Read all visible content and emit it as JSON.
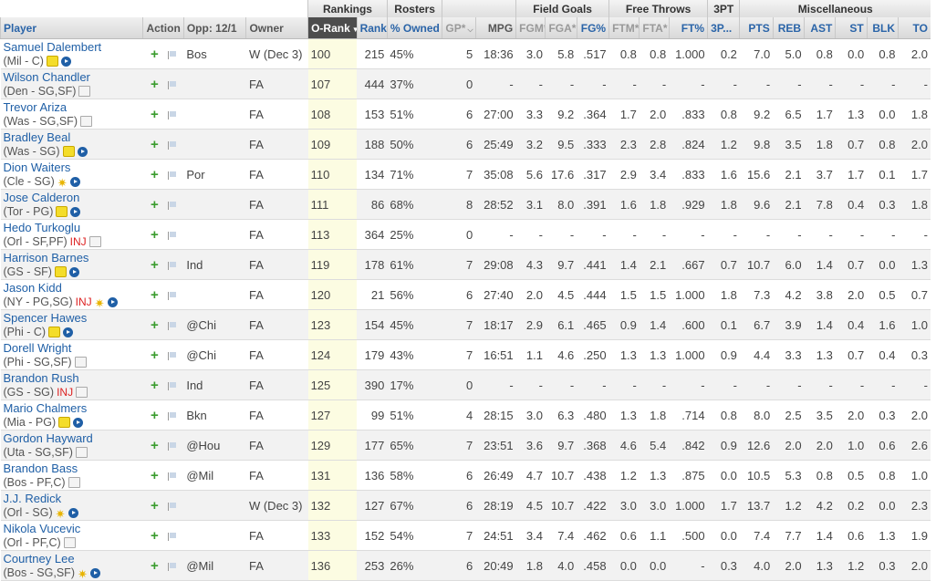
{
  "group_headers": {
    "rankings": "Rankings",
    "rosters": "Rosters",
    "field_goals": "Field Goals",
    "free_throws": "Free Throws",
    "three_pt": "3PT",
    "misc": "Miscellaneous"
  },
  "columns": {
    "player": "Player",
    "action": "Action",
    "opp": "Opp: 12/1",
    "owner": "Owner",
    "orank": "O-Rank",
    "rank": "Rank",
    "owned": "% Owned",
    "gp": "GP*",
    "mpg": "MPG",
    "fgm": "FGM*",
    "fga": "FGA*",
    "fgp": "FG%",
    "ftm": "FTM*",
    "fta": "FTA*",
    "ftp": "FT%",
    "tpm": "3P...",
    "pts": "PTS",
    "reb": "REB",
    "ast": "AST",
    "st": "ST",
    "blk": "BLK",
    "to": "TO"
  },
  "rows": [
    {
      "name": "Samuel Dalembert",
      "team": "(Mil - C)",
      "inj": "",
      "note": "yellow",
      "opp": "Bos",
      "owner": "W (Dec 3)",
      "orank": "100",
      "rank": "215",
      "owned": "45%",
      "gp": "5",
      "mpg": "18:36",
      "fgm": "3.0",
      "fga": "5.8",
      "fgp": ".517",
      "ftm": "0.8",
      "fta": "0.8",
      "ftp": "1.000",
      "tpm": "0.2",
      "pts": "7.0",
      "reb": "5.0",
      "ast": "0.8",
      "st": "0.0",
      "blk": "0.8",
      "to": "2.0"
    },
    {
      "name": "Wilson Chandler",
      "team": "(Den - SG,SF)",
      "inj": "",
      "note": "gray",
      "opp": "",
      "owner": "FA",
      "orank": "107",
      "rank": "444",
      "owned": "37%",
      "gp": "0",
      "mpg": "-",
      "fgm": "-",
      "fga": "-",
      "fgp": "-",
      "ftm": "-",
      "fta": "-",
      "ftp": "-",
      "tpm": "-",
      "pts": "-",
      "reb": "-",
      "ast": "-",
      "st": "-",
      "blk": "-",
      "to": "-"
    },
    {
      "name": "Trevor Ariza",
      "team": "(Was - SG,SF)",
      "inj": "",
      "note": "gray",
      "opp": "",
      "owner": "FA",
      "orank": "108",
      "rank": "153",
      "owned": "51%",
      "gp": "6",
      "mpg": "27:00",
      "fgm": "3.3",
      "fga": "9.2",
      "fgp": ".364",
      "ftm": "1.7",
      "fta": "2.0",
      "ftp": ".833",
      "tpm": "0.8",
      "pts": "9.2",
      "reb": "6.5",
      "ast": "1.7",
      "st": "1.3",
      "blk": "0.0",
      "to": "1.8"
    },
    {
      "name": "Bradley Beal",
      "team": "(Was - SG)",
      "inj": "",
      "note": "yellow",
      "opp": "",
      "owner": "FA",
      "orank": "109",
      "rank": "188",
      "owned": "50%",
      "gp": "6",
      "mpg": "25:49",
      "fgm": "3.2",
      "fga": "9.5",
      "fgp": ".333",
      "ftm": "2.3",
      "fta": "2.8",
      "ftp": ".824",
      "tpm": "1.2",
      "pts": "9.8",
      "reb": "3.5",
      "ast": "1.8",
      "st": "0.7",
      "blk": "0.8",
      "to": "2.0"
    },
    {
      "name": "Dion Waiters",
      "team": "(Cle - SG)",
      "inj": "",
      "note": "star",
      "opp": "Por",
      "owner": "FA",
      "orank": "110",
      "rank": "134",
      "owned": "71%",
      "gp": "7",
      "mpg": "35:08",
      "fgm": "5.6",
      "fga": "17.6",
      "fgp": ".317",
      "ftm": "2.9",
      "fta": "3.4",
      "ftp": ".833",
      "tpm": "1.6",
      "pts": "15.6",
      "reb": "2.1",
      "ast": "3.7",
      "st": "1.7",
      "blk": "0.1",
      "to": "1.7"
    },
    {
      "name": "Jose Calderon",
      "team": "(Tor - PG)",
      "inj": "",
      "note": "yellow",
      "opp": "",
      "owner": "FA",
      "orank": "111",
      "rank": "86",
      "owned": "68%",
      "gp": "8",
      "mpg": "28:52",
      "fgm": "3.1",
      "fga": "8.0",
      "fgp": ".391",
      "ftm": "1.6",
      "fta": "1.8",
      "ftp": ".929",
      "tpm": "1.8",
      "pts": "9.6",
      "reb": "2.1",
      "ast": "7.8",
      "st": "0.4",
      "blk": "0.3",
      "to": "1.8"
    },
    {
      "name": "Hedo Turkoglu",
      "team": "(Orl - SF,PF)",
      "inj": "INJ",
      "note": "gray",
      "opp": "",
      "owner": "FA",
      "orank": "113",
      "rank": "364",
      "owned": "25%",
      "gp": "0",
      "mpg": "-",
      "fgm": "-",
      "fga": "-",
      "fgp": "-",
      "ftm": "-",
      "fta": "-",
      "ftp": "-",
      "tpm": "-",
      "pts": "-",
      "reb": "-",
      "ast": "-",
      "st": "-",
      "blk": "-",
      "to": "-"
    },
    {
      "name": "Harrison Barnes",
      "team": "(GS - SF)",
      "inj": "",
      "note": "yellow",
      "opp": "Ind",
      "owner": "FA",
      "orank": "119",
      "rank": "178",
      "owned": "61%",
      "gp": "7",
      "mpg": "29:08",
      "fgm": "4.3",
      "fga": "9.7",
      "fgp": ".441",
      "ftm": "1.4",
      "fta": "2.1",
      "ftp": ".667",
      "tpm": "0.7",
      "pts": "10.7",
      "reb": "6.0",
      "ast": "1.4",
      "st": "0.7",
      "blk": "0.0",
      "to": "1.3"
    },
    {
      "name": "Jason Kidd",
      "team": "(NY - PG,SG)",
      "inj": "INJ",
      "note": "star",
      "opp": "",
      "owner": "FA",
      "orank": "120",
      "rank": "21",
      "owned": "56%",
      "gp": "6",
      "mpg": "27:40",
      "fgm": "2.0",
      "fga": "4.5",
      "fgp": ".444",
      "ftm": "1.5",
      "fta": "1.5",
      "ftp": "1.000",
      "tpm": "1.8",
      "pts": "7.3",
      "reb": "4.2",
      "ast": "3.8",
      "st": "2.0",
      "blk": "0.5",
      "to": "0.7"
    },
    {
      "name": "Spencer Hawes",
      "team": "(Phi - C)",
      "inj": "",
      "note": "yellow",
      "opp": "@Chi",
      "owner": "FA",
      "orank": "123",
      "rank": "154",
      "owned": "45%",
      "gp": "7",
      "mpg": "18:17",
      "fgm": "2.9",
      "fga": "6.1",
      "fgp": ".465",
      "ftm": "0.9",
      "fta": "1.4",
      "ftp": ".600",
      "tpm": "0.1",
      "pts": "6.7",
      "reb": "3.9",
      "ast": "1.4",
      "st": "0.4",
      "blk": "1.6",
      "to": "1.0"
    },
    {
      "name": "Dorell Wright",
      "team": "(Phi - SG,SF)",
      "inj": "",
      "note": "gray",
      "opp": "@Chi",
      "owner": "FA",
      "orank": "124",
      "rank": "179",
      "owned": "43%",
      "gp": "7",
      "mpg": "16:51",
      "fgm": "1.1",
      "fga": "4.6",
      "fgp": ".250",
      "ftm": "1.3",
      "fta": "1.3",
      "ftp": "1.000",
      "tpm": "0.9",
      "pts": "4.4",
      "reb": "3.3",
      "ast": "1.3",
      "st": "0.7",
      "blk": "0.4",
      "to": "0.3"
    },
    {
      "name": "Brandon Rush",
      "team": "(GS - SG)",
      "inj": "INJ",
      "note": "gray",
      "opp": "Ind",
      "owner": "FA",
      "orank": "125",
      "rank": "390",
      "owned": "17%",
      "gp": "0",
      "mpg": "-",
      "fgm": "-",
      "fga": "-",
      "fgp": "-",
      "ftm": "-",
      "fta": "-",
      "ftp": "-",
      "tpm": "-",
      "pts": "-",
      "reb": "-",
      "ast": "-",
      "st": "-",
      "blk": "-",
      "to": "-"
    },
    {
      "name": "Mario Chalmers",
      "team": "(Mia - PG)",
      "inj": "",
      "note": "yellow",
      "opp": "Bkn",
      "owner": "FA",
      "orank": "127",
      "rank": "99",
      "owned": "51%",
      "gp": "4",
      "mpg": "28:15",
      "fgm": "3.0",
      "fga": "6.3",
      "fgp": ".480",
      "ftm": "1.3",
      "fta": "1.8",
      "ftp": ".714",
      "tpm": "0.8",
      "pts": "8.0",
      "reb": "2.5",
      "ast": "3.5",
      "st": "2.0",
      "blk": "0.3",
      "to": "2.0"
    },
    {
      "name": "Gordon Hayward",
      "team": "(Uta - SG,SF)",
      "inj": "",
      "note": "gray",
      "opp": "@Hou",
      "owner": "FA",
      "orank": "129",
      "rank": "177",
      "owned": "65%",
      "gp": "7",
      "mpg": "23:51",
      "fgm": "3.6",
      "fga": "9.7",
      "fgp": ".368",
      "ftm": "4.6",
      "fta": "5.4",
      "ftp": ".842",
      "tpm": "0.9",
      "pts": "12.6",
      "reb": "2.0",
      "ast": "2.0",
      "st": "1.0",
      "blk": "0.6",
      "to": "2.6"
    },
    {
      "name": "Brandon Bass",
      "team": "(Bos - PF,C)",
      "inj": "",
      "note": "gray",
      "opp": "@Mil",
      "owner": "FA",
      "orank": "131",
      "rank": "136",
      "owned": "58%",
      "gp": "6",
      "mpg": "26:49",
      "fgm": "4.7",
      "fga": "10.7",
      "fgp": ".438",
      "ftm": "1.2",
      "fta": "1.3",
      "ftp": ".875",
      "tpm": "0.0",
      "pts": "10.5",
      "reb": "5.3",
      "ast": "0.8",
      "st": "0.5",
      "blk": "0.8",
      "to": "1.0"
    },
    {
      "name": "J.J. Redick",
      "team": "(Orl - SG)",
      "inj": "",
      "note": "star",
      "opp": "",
      "owner": "W (Dec 3)",
      "orank": "132",
      "rank": "127",
      "owned": "67%",
      "gp": "6",
      "mpg": "28:19",
      "fgm": "4.5",
      "fga": "10.7",
      "fgp": ".422",
      "ftm": "3.0",
      "fta": "3.0",
      "ftp": "1.000",
      "tpm": "1.7",
      "pts": "13.7",
      "reb": "1.2",
      "ast": "4.2",
      "st": "0.2",
      "blk": "0.0",
      "to": "2.3"
    },
    {
      "name": "Nikola Vucevic",
      "team": "(Orl - PF,C)",
      "inj": "",
      "note": "gray",
      "opp": "",
      "owner": "FA",
      "orank": "133",
      "rank": "152",
      "owned": "54%",
      "gp": "7",
      "mpg": "24:51",
      "fgm": "3.4",
      "fga": "7.4",
      "fgp": ".462",
      "ftm": "0.6",
      "fta": "1.1",
      "ftp": ".500",
      "tpm": "0.0",
      "pts": "7.4",
      "reb": "7.7",
      "ast": "1.4",
      "st": "0.6",
      "blk": "1.3",
      "to": "1.9"
    },
    {
      "name": "Courtney Lee",
      "team": "(Bos - SG,SF)",
      "inj": "",
      "note": "star",
      "opp": "@Mil",
      "owner": "FA",
      "orank": "136",
      "rank": "253",
      "owned": "26%",
      "gp": "6",
      "mpg": "20:49",
      "fgm": "1.8",
      "fga": "4.0",
      "fgp": ".458",
      "ftm": "0.0",
      "fta": "0.0",
      "ftp": "-",
      "tpm": "0.3",
      "pts": "4.0",
      "reb": "2.0",
      "ast": "1.3",
      "st": "1.2",
      "blk": "0.3",
      "to": "2.0"
    }
  ]
}
